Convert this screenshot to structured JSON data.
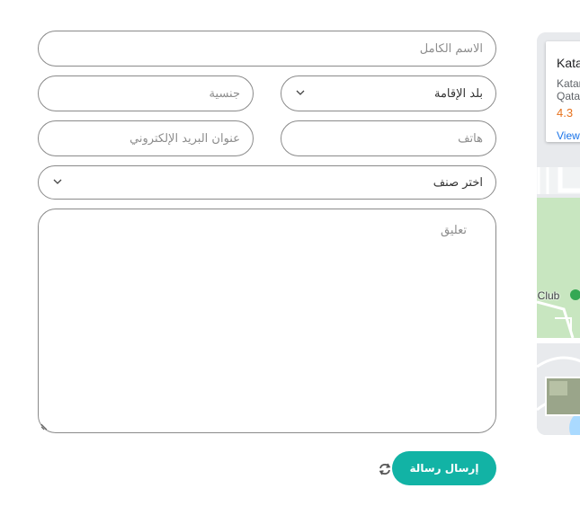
{
  "form": {
    "full_name_placeholder": "الاسم الكامل",
    "nationality_placeholder": "جنسية",
    "country_select_value": "بلد الإقامة",
    "email_placeholder": "عنوان البريد الإلكتروني",
    "phone_placeholder": "هاتف",
    "category_select_value": "اختر صنف",
    "comment_placeholder": "تعليق",
    "submit_label": "إرسال رسالة"
  },
  "map": {
    "place_title": "Katar",
    "address_line1": "Katar",
    "address_line2": "Qata",
    "rating": "4.3",
    "view_link": "View",
    "poi_label": "f Club"
  },
  "colors": {
    "accent": "#12b3a5",
    "border": "#8a8a8a",
    "map_green": "#c8e6c0",
    "rating_orange": "#e7711b"
  }
}
